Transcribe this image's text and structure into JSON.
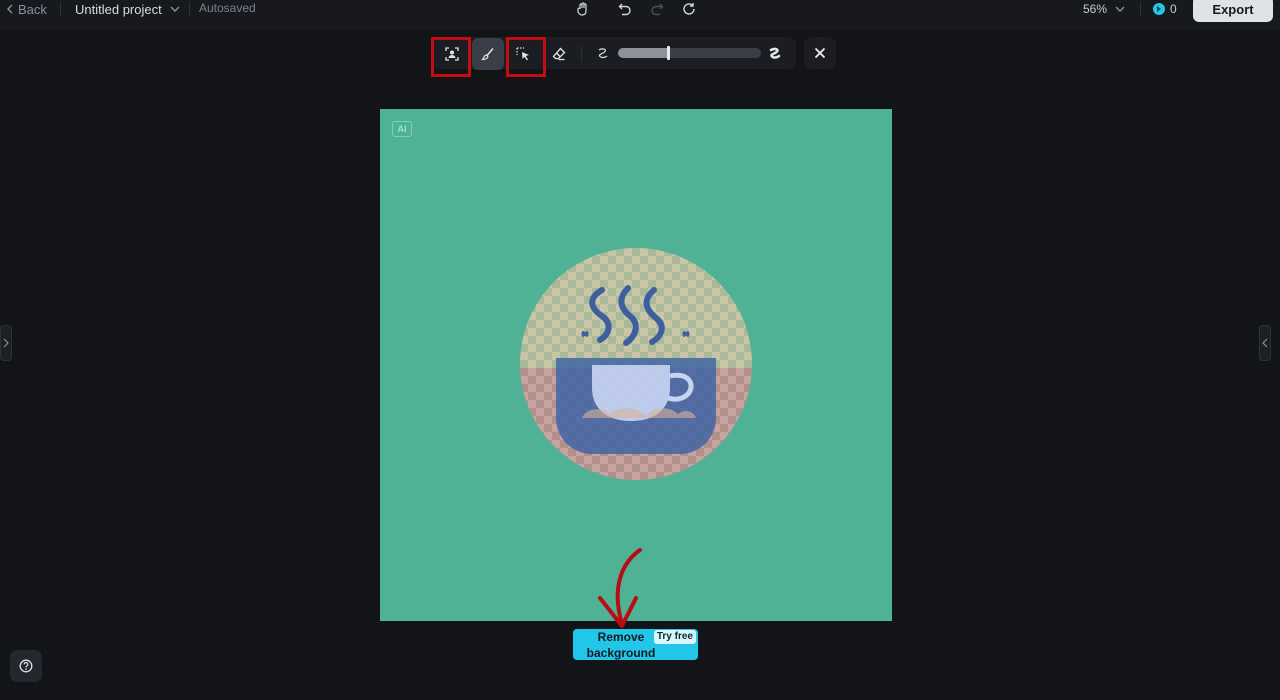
{
  "header": {
    "back_label": "Back",
    "project_title": "Untitled project",
    "save_status": "Autosaved",
    "zoom_level": "56%",
    "credits_count": "0",
    "export_label": "Export"
  },
  "toolbar": {
    "tools": [
      "person-select-icon",
      "brush-icon",
      "magic-select-icon",
      "eraser-icon"
    ],
    "active_tool": "brush-icon",
    "brush_size_fraction": 0.35
  },
  "canvas": {
    "ai_badge": "AI",
    "background_color": "#4fb294"
  },
  "actions": {
    "remove_background_label": "Remove background",
    "try_free_label": "Try free"
  },
  "colors": {
    "accent": "#21c6e8",
    "highlight": "#c40c12",
    "canvas_bg": "#4fb294",
    "mug_blue": "#3c63a6"
  }
}
